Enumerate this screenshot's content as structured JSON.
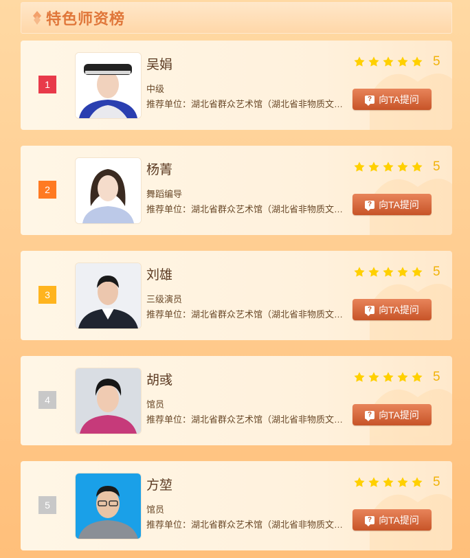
{
  "header": {
    "title": "特色师资榜"
  },
  "colors": {
    "rank1": "#e83a4a",
    "rank2": "#ff7a22",
    "rank3": "#ffb41e",
    "rank_other": "#c8c8c8",
    "star": "#ffd000",
    "button": "#d9643a"
  },
  "teachers": [
    {
      "rank": "1",
      "name": "吴娟",
      "level": "中级",
      "org": "推荐单位：湖北省群众艺术馆（湖北省非物质文化遗产保护中心）",
      "score": "5",
      "rating": 5,
      "ask_label": "向TA提问"
    },
    {
      "rank": "2",
      "name": "杨菁",
      "level": "舞蹈编导",
      "org": "推荐单位：湖北省群众艺术馆（湖北省非物质文化遗产保护中心）",
      "score": "5",
      "rating": 5,
      "ask_label": "向TA提问"
    },
    {
      "rank": "3",
      "name": "刘雄",
      "level": "三级演员",
      "org": "推荐单位：湖北省群众艺术馆（湖北省非物质文化遗产保护中心）",
      "score": "5",
      "rating": 5,
      "ask_label": "向TA提问"
    },
    {
      "rank": "4",
      "name": "胡彧",
      "level": "馆员",
      "org": "推荐单位：湖北省群众艺术馆（湖北省非物质文化遗产保护中心）",
      "score": "5",
      "rating": 5,
      "ask_label": "向TA提问"
    },
    {
      "rank": "5",
      "name": "方堃",
      "level": "馆员",
      "org": "推荐单位：湖北省群众艺术馆（湖北省非物质文化遗产保护中心）",
      "score": "5",
      "rating": 5,
      "ask_label": "向TA提问"
    }
  ]
}
